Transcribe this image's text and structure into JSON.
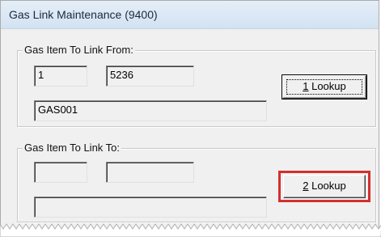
{
  "window": {
    "title": "Gas Link Maintenance (9400)"
  },
  "from_group": {
    "label": "Gas Item To Link From:",
    "field1": "1",
    "field2": "5236",
    "description": "GAS001",
    "lookup": {
      "mnemonic": "1",
      "text": " Lookup"
    }
  },
  "to_group": {
    "label": "Gas Item To Link To:",
    "field1": "",
    "field2": "",
    "description": "",
    "lookup": {
      "mnemonic": "2",
      "text": " Lookup"
    },
    "highlight_color": "#d32f2f"
  }
}
